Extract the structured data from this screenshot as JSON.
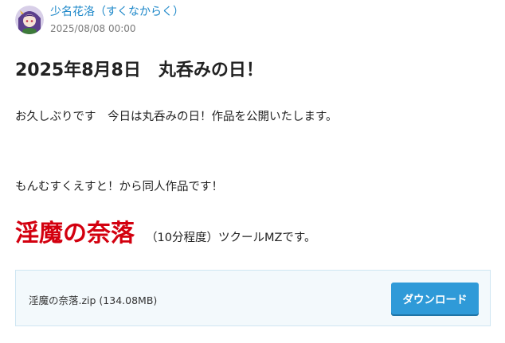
{
  "author": {
    "name": "少名花洛（すくなからく）",
    "avatar_icon": "character-avatar-icon"
  },
  "post": {
    "date": "2025/08/08 00:00",
    "title": "2025年8月8日　丸呑みの日！",
    "paragraph1": "お久しぶりです　今日は丸呑みの日！作品を公開いたします。",
    "paragraph2": "もんむすくえすと！から同人作品です！",
    "work_title": "淫魔の奈落",
    "work_note": "（10分程度）ツクールMZです。"
  },
  "attachment": {
    "file_name": "淫魔の奈落.zip (134.08MB)",
    "download_label": "ダウンロード"
  },
  "colors": {
    "link": "#1e88c9",
    "work_title": "#d3000f",
    "button": "#2f9ad8",
    "file_box_bg": "#f3f9fc"
  }
}
